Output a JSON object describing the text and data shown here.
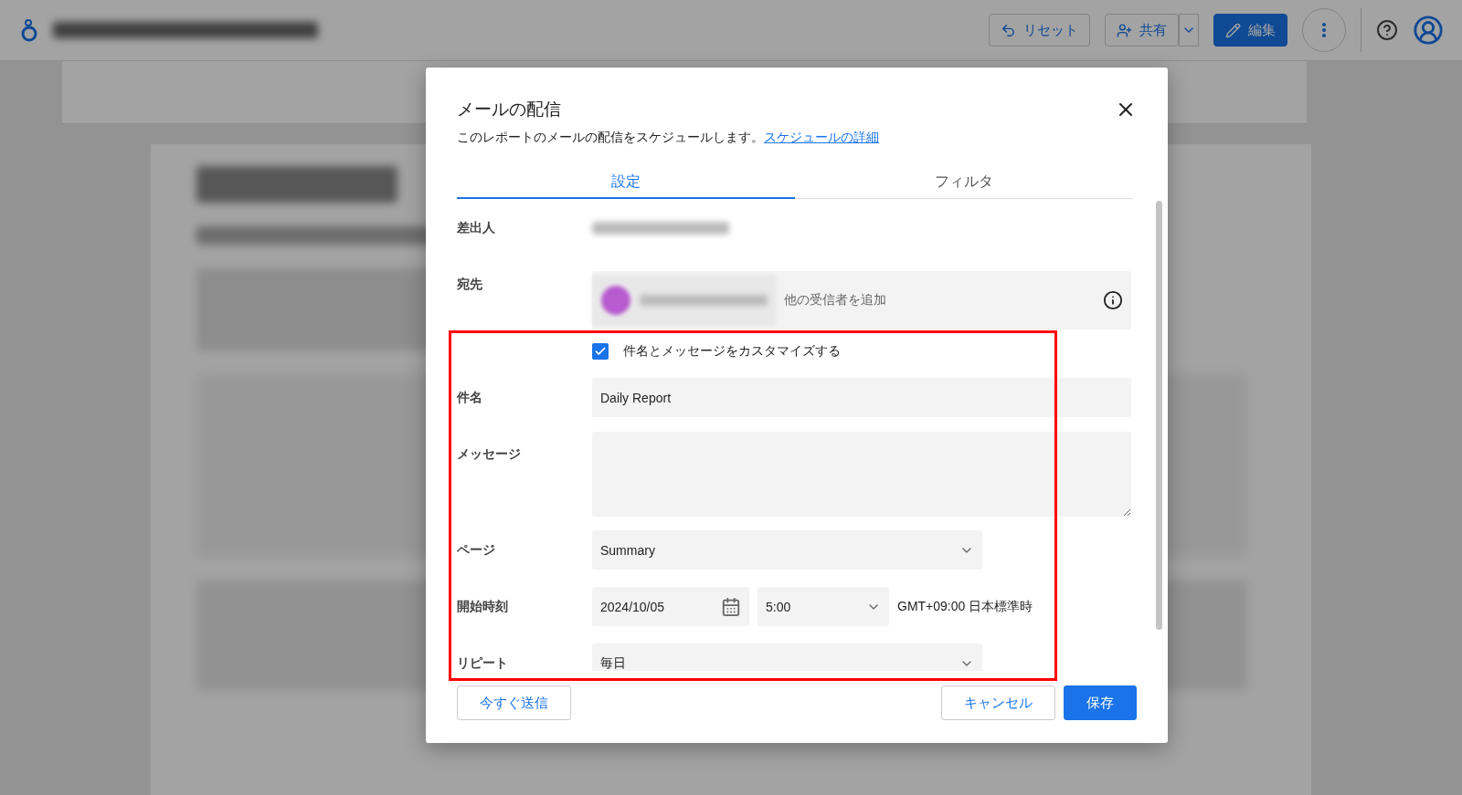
{
  "topbar": {
    "actions": [
      {
        "kind": "reset",
        "label": "リセット"
      },
      {
        "kind": "share",
        "label": "共有"
      },
      {
        "kind": "edit",
        "label": "編集"
      }
    ]
  },
  "dialog": {
    "title": "メールの配信",
    "description": "このレポートのメールの配信をスケジュールします。",
    "link": "スケジュールの詳細",
    "tabs": [
      {
        "label": "設定",
        "selected": true
      },
      {
        "label": "フィルタ",
        "selected": false
      }
    ],
    "sender": {
      "label": "差出人"
    },
    "recipients": {
      "label": "宛先",
      "placeholder": "他の受信者を追加"
    },
    "customize": {
      "label": "件名とメッセージをカスタマイズする",
      "checked": true
    },
    "subject": {
      "label": "件名",
      "value": "Daily Report"
    },
    "message": {
      "label": "メッセージ"
    },
    "page": {
      "label": "ページ",
      "value": "Summary"
    },
    "start": {
      "label": "開始時刻",
      "date": "2024/10/05",
      "time": "5:00",
      "timezone": "GMT+09:00 日本標準時"
    },
    "repeat": {
      "label": "リピート",
      "value": "毎日"
    },
    "buttons": [
      {
        "kind": "send_now",
        "label": "今すぐ送信"
      },
      {
        "kind": "cancel",
        "label": "キャンセル"
      },
      {
        "kind": "save",
        "label": "保存"
      }
    ]
  }
}
